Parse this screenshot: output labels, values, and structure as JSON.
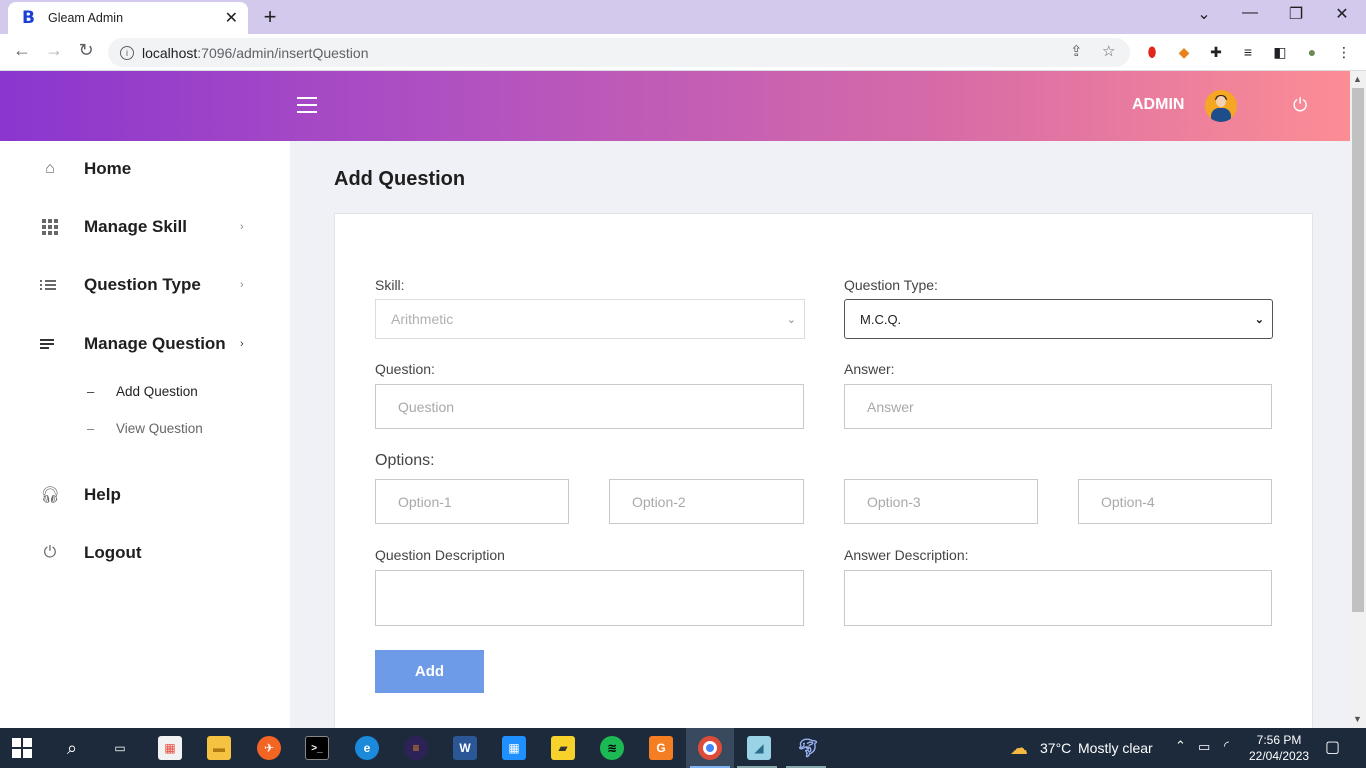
{
  "browser": {
    "tab_title": "Gleam Admin",
    "favicon_letter": "B",
    "new_tab": "+",
    "url_host": "localhost",
    "url_path": ":7096/admin/insertQuestion"
  },
  "header": {
    "admin_label": "ADMIN"
  },
  "sidebar": {
    "items": [
      {
        "label": "Home",
        "icon": "home-icon"
      },
      {
        "label": "Manage Skill",
        "icon": "grid-icon"
      },
      {
        "label": "Question Type",
        "icon": "list-icon"
      },
      {
        "label": "Manage Question",
        "icon": "menu-icon"
      },
      {
        "label": "Help",
        "icon": "headset-icon"
      },
      {
        "label": "Logout",
        "icon": "power-icon"
      }
    ],
    "subitems": [
      {
        "label": "Add Question"
      },
      {
        "label": "View Question"
      }
    ]
  },
  "main": {
    "title": "Add Question",
    "skill_label": "Skill:",
    "skill_value": "Arithmetic",
    "qtype_label": "Question Type:",
    "qtype_value": "M.C.Q.",
    "question_label": "Question:",
    "question_placeholder": "Question",
    "answer_label": "Answer:",
    "answer_placeholder": "Answer",
    "options_label": "Options:",
    "options": [
      "Option-1",
      "Option-2",
      "Option-3",
      "Option-4"
    ],
    "qdesc_label": "Question Description",
    "adesc_label": "Answer Description:",
    "add_button": "Add"
  },
  "taskbar": {
    "weather_temp": "37°C",
    "weather_text": "Mostly clear",
    "time": "7:56 PM",
    "date": "22/04/2023"
  },
  "colors": {
    "header_gradient_start": "#8a36cf",
    "header_gradient_end": "#fc8d95",
    "add_button": "#6e9be8",
    "taskbar": "#1c2a3b"
  }
}
